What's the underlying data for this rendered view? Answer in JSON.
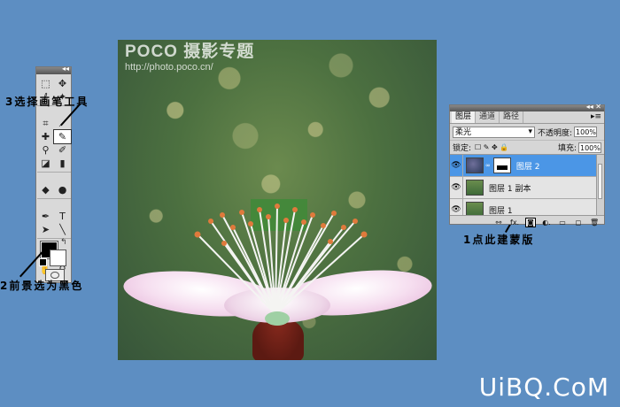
{
  "photo": {
    "watermark_brand": "POCO 摄影专题",
    "watermark_url": "http://photo.poco.cn/"
  },
  "toolbox": {
    "collapse_glyph": "◂◂",
    "tools": [
      {
        "name": "marquee-icon",
        "glyph": "⬚"
      },
      {
        "name": "move-icon",
        "glyph": "✥"
      },
      {
        "name": "lasso-icon",
        "glyph": "ℓ"
      },
      {
        "name": "magic-wand-icon",
        "glyph": "✦"
      },
      {
        "name": "crop-icon",
        "glyph": "⌗"
      },
      {
        "name": "slice-icon",
        "glyph": "⟋"
      },
      {
        "name": "healing-brush-icon",
        "glyph": "✚"
      },
      {
        "name": "brush-icon",
        "glyph": "✎",
        "active": true
      },
      {
        "name": "clone-stamp-icon",
        "glyph": "⚲"
      },
      {
        "name": "history-brush-icon",
        "glyph": "✐"
      },
      {
        "name": "eraser-icon",
        "glyph": "◪"
      },
      {
        "name": "gradient-icon",
        "glyph": "▮"
      },
      {
        "name": "blur-icon",
        "glyph": "◆"
      },
      {
        "name": "dodge-icon",
        "glyph": "●"
      },
      {
        "name": "pen-icon",
        "glyph": "✒"
      },
      {
        "name": "type-icon",
        "glyph": "T"
      },
      {
        "name": "path-selection-icon",
        "glyph": "➤"
      },
      {
        "name": "line-icon",
        "glyph": "╲"
      },
      {
        "name": "rotate-3d-icon",
        "glyph": "↻"
      },
      {
        "name": "orbit-3d-icon",
        "glyph": "⟲"
      },
      {
        "name": "hand-icon",
        "glyph": "✋"
      },
      {
        "name": "zoom-icon",
        "glyph": "⚲"
      }
    ],
    "swap_glyph": "↰"
  },
  "annotations": {
    "step3": "3选择画笔工具",
    "step2": "2前景选为黑色",
    "step1": "1点此建蒙版"
  },
  "layers_panel": {
    "collapse_glyph": "◂◂ ✕",
    "tabs": [
      "图层",
      "通道",
      "路径"
    ],
    "menu_glyph": "▸≡",
    "blend_mode": "柔光",
    "opacity_label": "不透明度:",
    "opacity_value": "100%",
    "lock_label": "锁定:",
    "lock_icons": "☐ ✎ ✥ 🔒",
    "fill_label": "填充:",
    "fill_value": "100%",
    "layers": [
      {
        "name": "图层 2",
        "visible_glyph": "👁",
        "selected": true
      },
      {
        "name": "图层 1 副本",
        "visible_glyph": "👁",
        "selected": false
      },
      {
        "name": "图层 1",
        "visible_glyph": "👁",
        "selected": false
      }
    ],
    "bottom_icons": [
      "⚯",
      "fx.",
      "◙",
      "◐.",
      "▭",
      "◻",
      "🗑"
    ]
  },
  "site_logo": "UiBQ.CoM"
}
